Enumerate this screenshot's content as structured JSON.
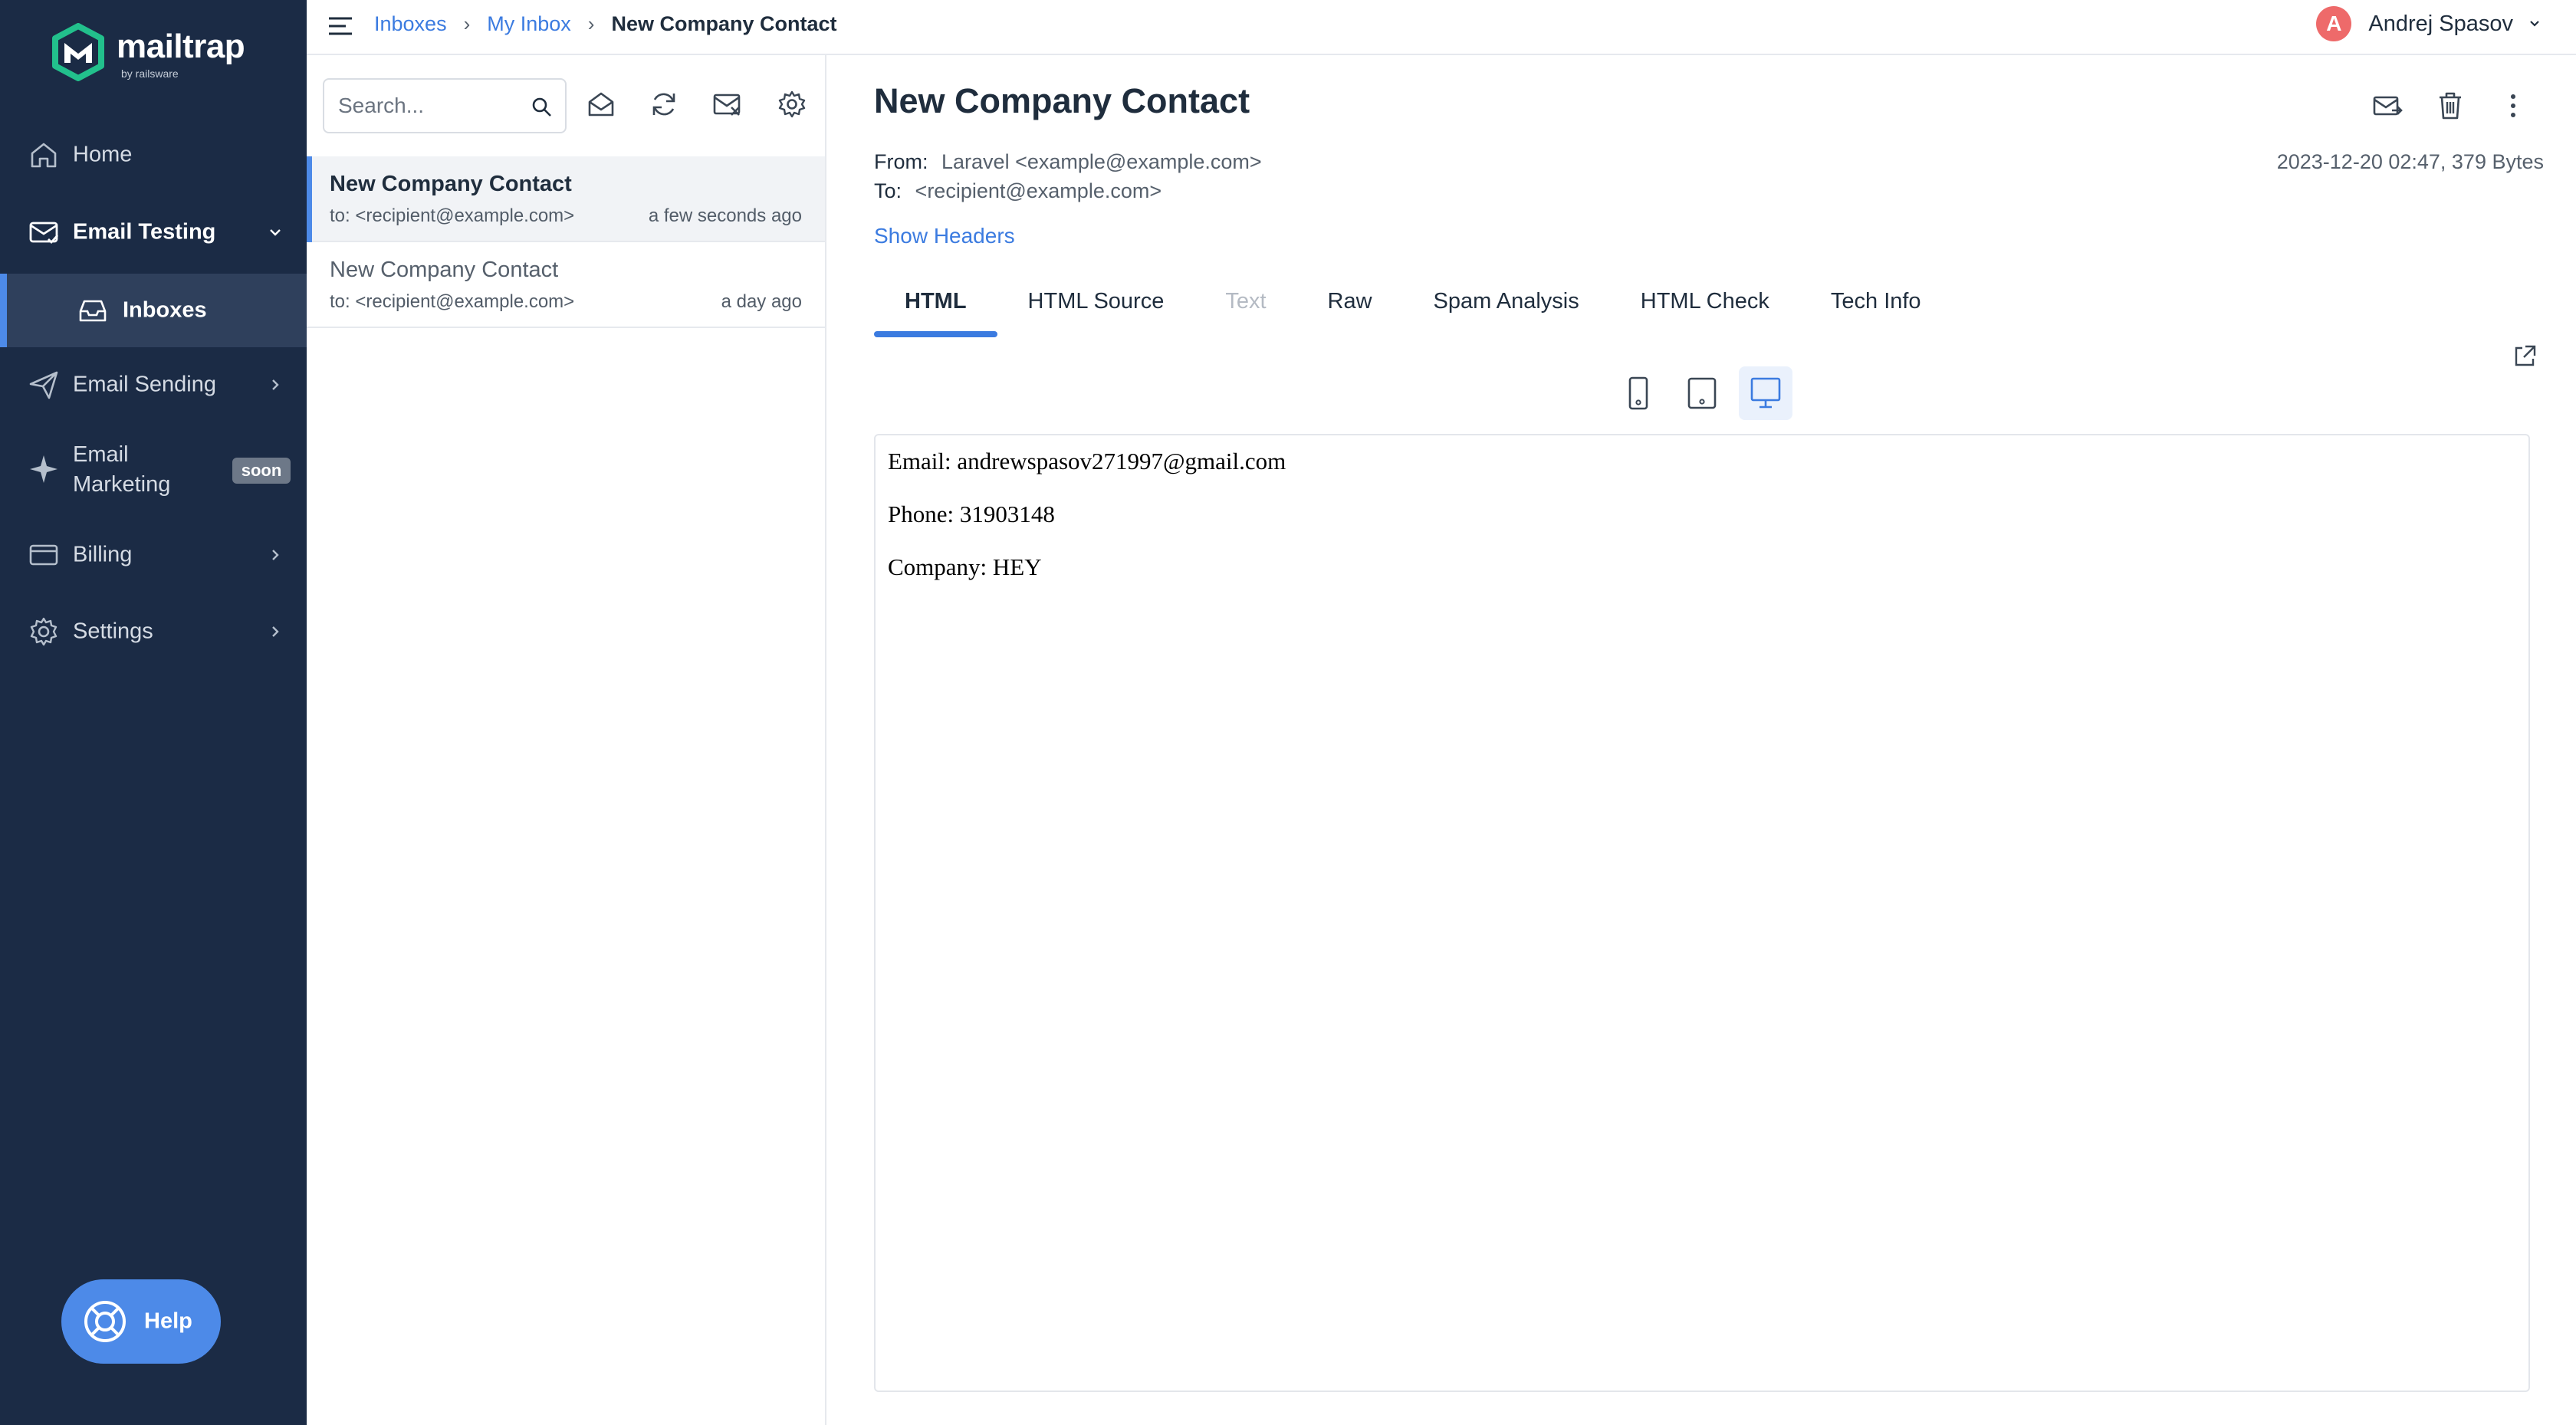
{
  "sidebar": {
    "logo_text": "mailtrap",
    "logo_sub": "by railsware",
    "items": {
      "home": "Home",
      "email_testing": "Email Testing",
      "inboxes": "Inboxes",
      "email_sending": "Email Sending",
      "email_marketing_line1": "Email",
      "email_marketing_line2": "Marketing",
      "soon_badge": "soon",
      "billing": "Billing",
      "settings": "Settings"
    },
    "help_label": "Help"
  },
  "header": {
    "breadcrumb": [
      "Inboxes",
      "My Inbox",
      "New Company Contact"
    ],
    "separator": "›",
    "user_initial": "A",
    "user_name": "Andrej Spasov"
  },
  "list": {
    "search_placeholder": "Search...",
    "messages": [
      {
        "subject": "New Company Contact",
        "to": "to: <recipient@example.com>",
        "time": "a few seconds ago"
      },
      {
        "subject": "New Company Contact",
        "to": "to: <recipient@example.com>",
        "time": "a day ago"
      }
    ]
  },
  "message": {
    "title": "New Company Contact",
    "from_label": "From:",
    "from_value": "Laravel <example@example.com>",
    "to_label": "To:",
    "to_value": "<recipient@example.com>",
    "meta": "2023-12-20 02:47, 379 Bytes",
    "show_headers": "Show Headers",
    "tabs": [
      "HTML",
      "HTML Source",
      "Text",
      "Raw",
      "Spam Analysis",
      "HTML Check",
      "Tech Info"
    ],
    "body": [
      "Email: andrewspasov271997@gmail.com",
      "Phone: 31903148",
      "Company: HEY"
    ]
  },
  "colors": {
    "sidebar_bg": "#1b2b45",
    "accent": "#3b7be0",
    "avatar": "#ee6a6a"
  }
}
